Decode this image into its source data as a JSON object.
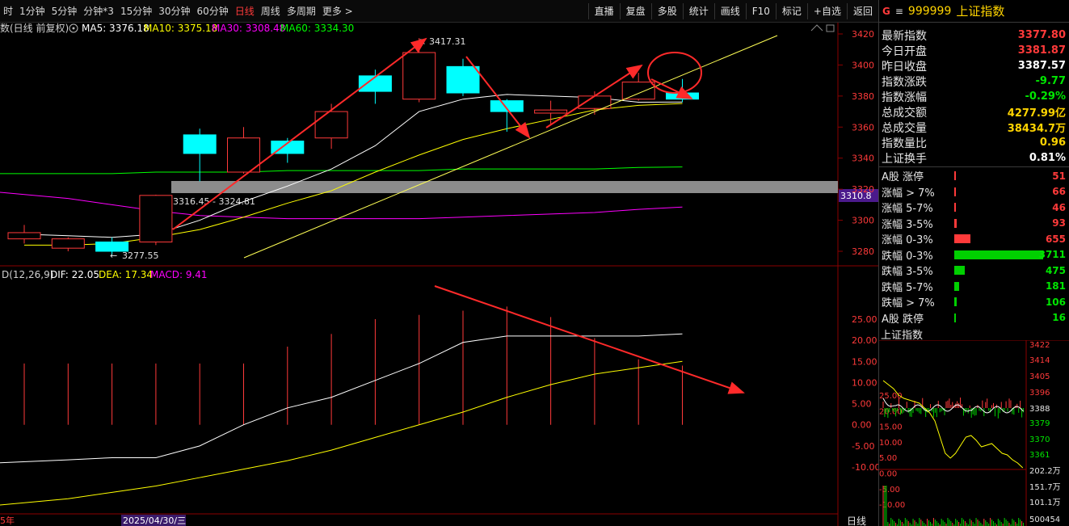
{
  "toolbar": {
    "periods": [
      "时",
      "1分钟",
      "5分钟",
      "分钟*3",
      "15分钟",
      "30分钟",
      "60分钟",
      "日线",
      "周线",
      "多周期",
      "更多 >"
    ],
    "active_period": "日线",
    "tools": [
      "直播",
      "复盘",
      "多股",
      "统计",
      "画线",
      "F10",
      "标记",
      "+自选",
      "返回"
    ]
  },
  "ma_legend": {
    "prefix": "数(日线 前复权)",
    "ma5": "MA5: 3376.18",
    "ma10": "MA10: 3375.18",
    "ma30": "MA30: 3308.48",
    "ma60": "MA60: 3334.30"
  },
  "macd_legend": {
    "name": "D(12,26,9)",
    "dif": "DIF: 22.05",
    "dea": "DEA: 17.34",
    "macd": "MACD: 9.41"
  },
  "annotations": {
    "high_label": "3417.31",
    "low_label": "3277.55",
    "gap_label": "3316.45 - 3324.81",
    "price_tag": "3310.8",
    "date_label": "2025/04/30/三",
    "left_date_fragment": "5年",
    "bottom_axis_label": "日线"
  },
  "price_axis": [
    "3420",
    "3400",
    "3380",
    "3360",
    "3340",
    "3320",
    "3300",
    "3280"
  ],
  "macd_axis": [
    "25.00",
    "20.00",
    "15.00",
    "10.00",
    "5.00",
    "0.00",
    "-5.00",
    "-10.00"
  ],
  "colors": {
    "up": "#ff3a3a",
    "down": "#00ffff",
    "ma5": "#ffffff",
    "ma10": "#ffff00",
    "ma30": "#ff00ff",
    "ma60": "#00ff00",
    "grid": "#8b0000"
  },
  "quote": {
    "g_icon": "G",
    "menu_icon": "≡",
    "code": "999999",
    "name": "上证指数",
    "stats": [
      {
        "label": "最新指数",
        "value": "3377.80",
        "tone": "red"
      },
      {
        "label": "今日开盘",
        "value": "3381.87",
        "tone": "red"
      },
      {
        "label": "昨日收盘",
        "value": "3387.57",
        "tone": "white"
      },
      {
        "label": "指数涨跌",
        "value": "-9.77",
        "tone": "green"
      },
      {
        "label": "指数涨幅",
        "value": "-0.29%",
        "tone": "green"
      },
      {
        "label": "总成交额",
        "value": "4277.99亿",
        "tone": "yellow"
      },
      {
        "label": "总成交量",
        "value": "38434.7万",
        "tone": "yellow"
      },
      {
        "label": "指数量比",
        "value": "0.96",
        "tone": "yellow"
      },
      {
        "label": "上证换手",
        "value": "0.81%",
        "tone": "white"
      }
    ]
  },
  "breadth": [
    {
      "label": "A股 涨停",
      "value": "51",
      "bar": 0.02,
      "color": "#ff3a3a",
      "tone": "red"
    },
    {
      "label": "涨幅 > 7%",
      "value": "66",
      "bar": 0.02,
      "color": "#ff3a3a",
      "tone": "red"
    },
    {
      "label": "涨幅 5-7%",
      "value": "46",
      "bar": 0.015,
      "color": "#ff3a3a",
      "tone": "red"
    },
    {
      "label": "涨幅 3-5%",
      "value": "93",
      "bar": 0.03,
      "color": "#ff3a3a",
      "tone": "red"
    },
    {
      "label": "涨幅 0-3%",
      "value": "655",
      "bar": 0.18,
      "color": "#ff3a3a",
      "tone": "red"
    },
    {
      "label": "跌幅 0-3%",
      "value": "3711",
      "bar": 1.0,
      "color": "#00d000",
      "tone": "green"
    },
    {
      "label": "跌幅 3-5%",
      "value": "475",
      "bar": 0.12,
      "color": "#00d000",
      "tone": "green"
    },
    {
      "label": "跌幅 5-7%",
      "value": "181",
      "bar": 0.05,
      "color": "#00d000",
      "tone": "green"
    },
    {
      "label": "跌幅 > 7%",
      "value": "106",
      "bar": 0.03,
      "color": "#00d000",
      "tone": "green"
    },
    {
      "label": "A股 跌停",
      "value": "16",
      "bar": 0.01,
      "color": "#00d000",
      "tone": "green"
    }
  ],
  "mini_chart": {
    "title": "上证指数",
    "left_axis": [
      "25.00",
      "20.00",
      "15.00",
      "10.00",
      "5.00",
      "0.00",
      "-5.00",
      "-10.00"
    ],
    "right_axis": [
      "3422",
      "3414",
      "3405",
      "3396",
      "3388",
      "3379",
      "3370",
      "3361",
      "202.2万",
      "151.7万",
      "101.1万",
      "500454"
    ]
  },
  "chart_data": {
    "type": "candlestick",
    "candles": [
      {
        "o": 3288,
        "c": 3292,
        "h": 3297,
        "l": 3285
      },
      {
        "o": 3282,
        "c": 3288,
        "h": 3289,
        "l": 3280
      },
      {
        "o": 3286,
        "c": 3280,
        "h": 3289,
        "l": 3277.55
      },
      {
        "o": 3286,
        "c": 3316,
        "h": 3316.45,
        "l": 3284
      },
      {
        "o": 3355,
        "c": 3343,
        "h": 3359,
        "l": 3325
      },
      {
        "o": 3331,
        "c": 3353,
        "h": 3360,
        "l": 3330
      },
      {
        "o": 3351,
        "c": 3343,
        "h": 3353,
        "l": 3337
      },
      {
        "o": 3353,
        "c": 3370,
        "h": 3375,
        "l": 3346
      },
      {
        "o": 3393,
        "c": 3383,
        "h": 3397,
        "l": 3375
      },
      {
        "o": 3378,
        "c": 3408,
        "h": 3417.31,
        "l": 3376
      },
      {
        "o": 3399,
        "c": 3382,
        "h": 3404,
        "l": 3380
      },
      {
        "o": 3377,
        "c": 3370,
        "h": 3378,
        "l": 3357
      },
      {
        "o": 3369,
        "c": 3371,
        "h": 3377,
        "l": 3362
      },
      {
        "o": 3372,
        "c": 3380,
        "h": 3383,
        "l": 3368
      },
      {
        "o": 3378,
        "c": 3389,
        "h": 3395,
        "l": 3377
      },
      {
        "o": 3382,
        "c": 3378,
        "h": 3391,
        "l": 3376
      }
    ],
    "ma5": [
      3291,
      3290,
      3289,
      3291,
      3300,
      3312,
      3322,
      3333,
      3348,
      3370,
      3378,
      3381,
      3380,
      3379,
      3376,
      3376.18
    ],
    "ma10": [
      3284,
      3284,
      3285,
      3289,
      3294,
      3302,
      3311,
      3319,
      3331,
      3342,
      3352,
      3359,
      3365,
      3371,
      3374,
      3375.18
    ],
    "ma30": [
      3318,
      3314,
      3310,
      3306,
      3303,
      3302,
      3301,
      3301,
      3301,
      3301,
      3302,
      3303,
      3304,
      3305,
      3307,
      3308.48
    ],
    "ma60": [
      3330,
      3330,
      3330,
      3331,
      3331,
      3331,
      3332,
      3332,
      3332,
      3332,
      3333,
      3333,
      3333,
      3333,
      3334,
      3334.3
    ],
    "macd_bars": [
      14.5,
      14.5,
      14.5,
      14.5,
      14.5,
      14.5,
      18.5,
      21.5,
      25.0,
      26.0,
      27.0,
      28.0,
      25.5,
      20.5,
      15.5,
      14.0,
      12.5,
      9.41
    ],
    "dif": [
      -9.0,
      -8.3,
      -7.8,
      -7.8,
      -5.0,
      0.0,
      4.0,
      6.5,
      10.5,
      14.5,
      19.5,
      21.0,
      21.0,
      21.0,
      21.0,
      21.5,
      22.5,
      22.05
    ],
    "dea": [
      -19.0,
      -17.5,
      -16.0,
      -14.5,
      -12.5,
      -10.5,
      -8.5,
      -6.0,
      -3.0,
      0.0,
      3.0,
      6.5,
      9.5,
      12.0,
      13.5,
      15.0,
      16.2,
      17.34
    ],
    "ylim_price": [
      3270,
      3425
    ],
    "ylim_macd": [
      -13,
      29
    ]
  }
}
